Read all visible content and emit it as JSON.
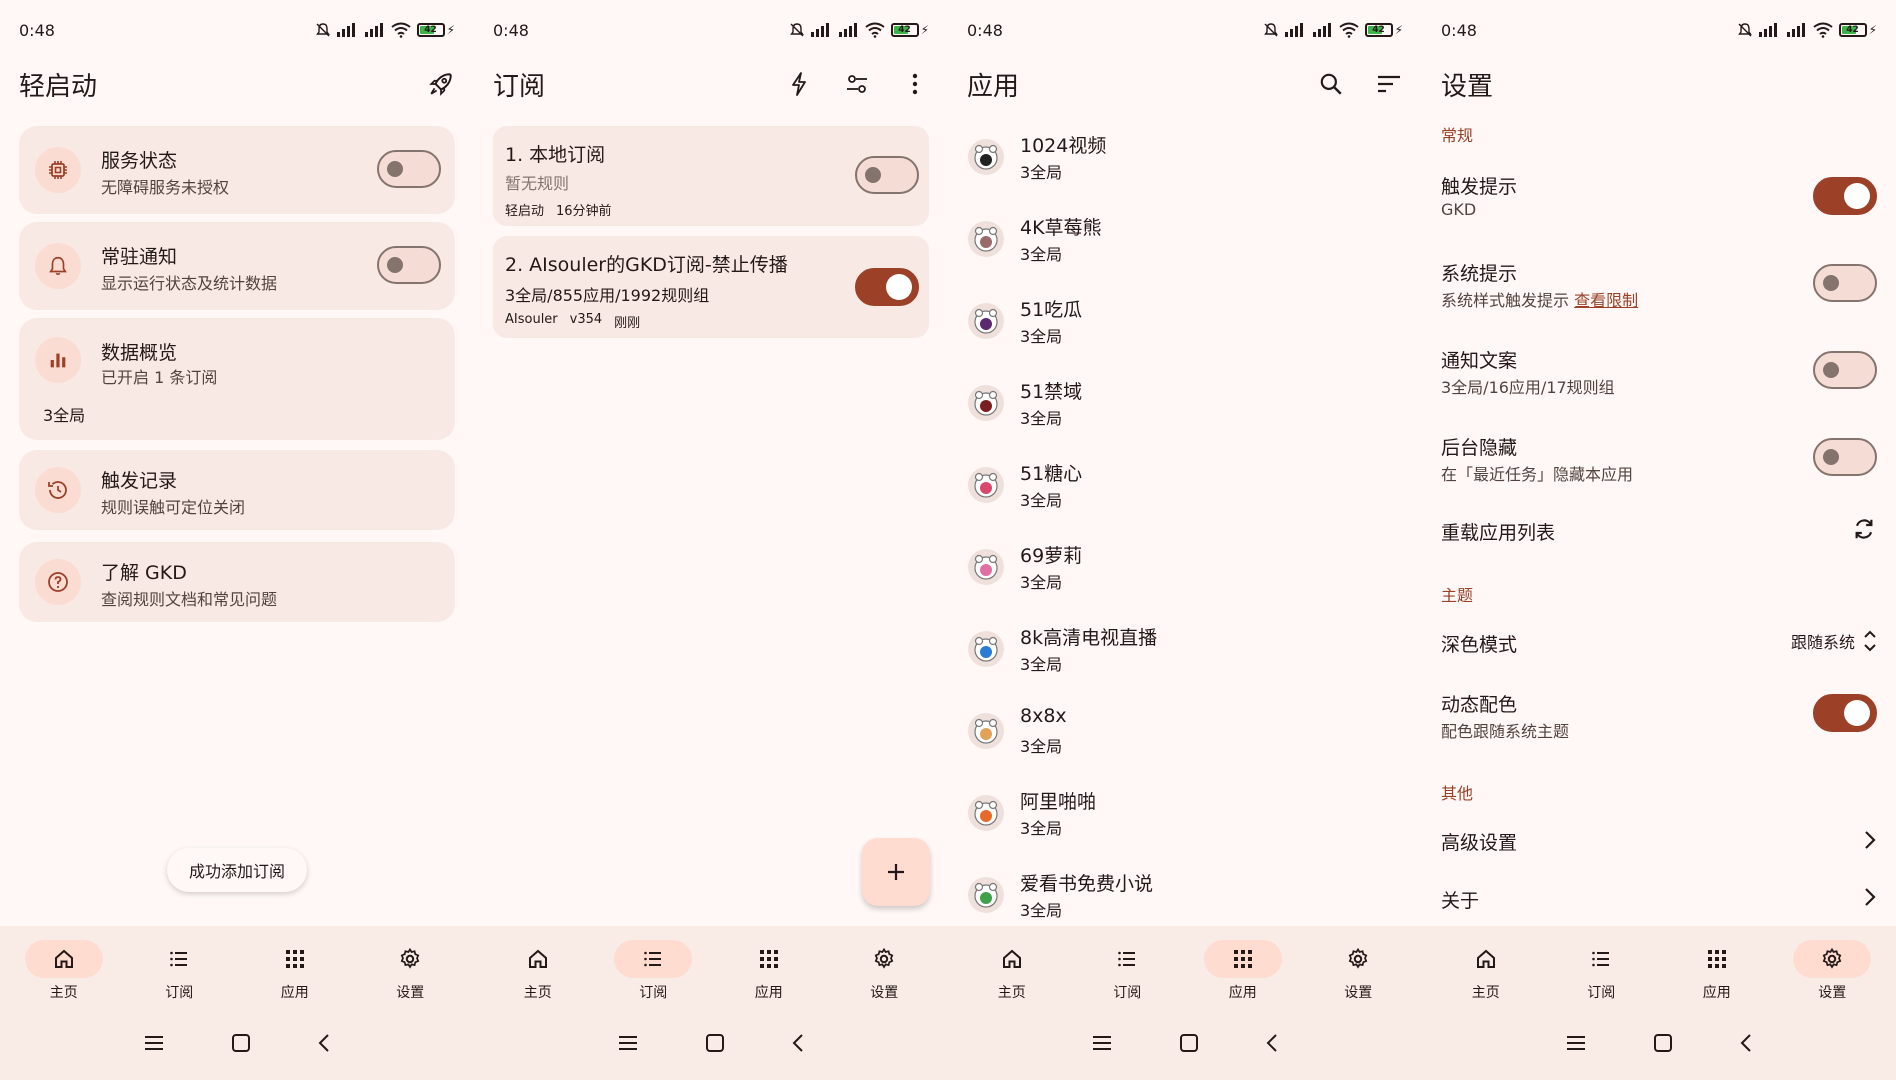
{
  "status": {
    "time": "0:48",
    "battery": "42"
  },
  "nav_labels": [
    "主页",
    "订阅",
    "应用",
    "设置"
  ],
  "home": {
    "title": "轻启动",
    "cards": [
      {
        "title": "服务状态",
        "subtitle": "无障碍服务未授权",
        "toggle": false,
        "icon": "chip-icon"
      },
      {
        "title": "常驻通知",
        "subtitle": "显示运行状态及统计数据",
        "toggle": false,
        "icon": "bell-icon"
      },
      {
        "title": "数据概览",
        "subtitle": "已开启 1 条订阅",
        "extra": "3全局",
        "icon": "bar-chart-icon"
      },
      {
        "title": "触发记录",
        "subtitle": "规则误触可定位关闭",
        "icon": "history-icon"
      },
      {
        "title": "了解 GKD",
        "subtitle": "查阅规则文档和常见问题",
        "icon": "help-icon"
      }
    ],
    "snackbar": "成功添加订阅"
  },
  "subs": {
    "title": "订阅",
    "items": [
      {
        "title": "1. 本地订阅",
        "mid": "暂无规则",
        "foot": [
          "轻启动",
          "16分钟前"
        ],
        "enabled": false
      },
      {
        "title": "2. AIsouler的GKD订阅-禁止传播",
        "mid": "3全局/855应用/1992规则组",
        "foot": [
          "AIsouler",
          "v354",
          "刚刚"
        ],
        "enabled": true
      }
    ]
  },
  "apps": {
    "title": "应用",
    "items": [
      {
        "name": "1024视频",
        "sub": "3全局",
        "color": "#222222"
      },
      {
        "name": "4K草莓熊",
        "sub": "3全局",
        "color": "#9a6a6a"
      },
      {
        "name": "51吃瓜",
        "sub": "3全局",
        "color": "#5b2a6e"
      },
      {
        "name": "51禁域",
        "sub": "3全局",
        "color": "#7a1f1f"
      },
      {
        "name": "51糖心",
        "sub": "3全局",
        "color": "#d9486a"
      },
      {
        "name": "69萝莉",
        "sub": "3全局",
        "color": "#e06fa4"
      },
      {
        "name": "8k高清电视直播",
        "sub": "3全局",
        "color": "#2b7cd3"
      },
      {
        "name": "8x8x",
        "sub": "3全局",
        "color": "#e2a25a"
      },
      {
        "name": "阿里啪啪",
        "sub": "3全局",
        "color": "#e86a2a"
      },
      {
        "name": "爱看书免费小说",
        "sub": "3全局",
        "color": "#3fa04a"
      }
    ]
  },
  "settings": {
    "title": "设置",
    "sec_general": "常规",
    "trigger_tip": {
      "title": "触发提示",
      "sub": "GKD",
      "on": true
    },
    "system_tip": {
      "title": "系统提示",
      "sub": "系统样式触发提示",
      "link": "查看限制",
      "on": false
    },
    "notify_text": {
      "title": "通知文案",
      "sub": "3全局/16应用/17规则组",
      "on": false
    },
    "bg_hide": {
      "title": "后台隐藏",
      "sub": "在「最近任务」隐藏本应用",
      "on": false
    },
    "reload": {
      "title": "重载应用列表"
    },
    "sec_theme": "主题",
    "dark_mode": {
      "title": "深色模式",
      "value": "跟随系统"
    },
    "dynamic_color": {
      "title": "动态配色",
      "sub": "配色跟随系统主题",
      "on": true
    },
    "sec_other": "其他",
    "advanced": "高级设置",
    "about": "关于"
  },
  "colors": {
    "primary": "#9c4128",
    "surface": "#fff8f6",
    "card": "#f9e9e4",
    "pill": "#ffdbd0"
  }
}
